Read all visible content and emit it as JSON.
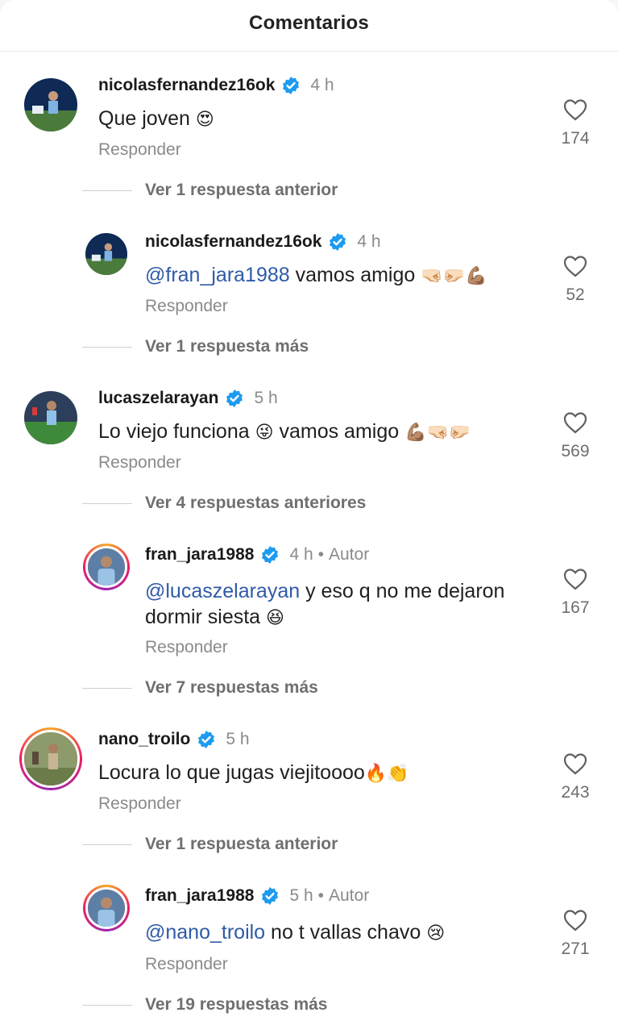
{
  "header": {
    "title": "Comentarios"
  },
  "labels": {
    "reply": "Responder",
    "author": "Autor"
  },
  "comments": [
    {
      "username": "nicolasfernandez16ok",
      "time": "4 h",
      "mention": "",
      "text": "Que joven",
      "emoji": "😍",
      "likes": "174"
    },
    {
      "username": "nicolasfernandez16ok",
      "time": "4 h",
      "mention": "@fran_jara1988",
      "text": " vamos amigo ",
      "emoji": "🤜🏻🤛🏻💪🏽",
      "likes": "52"
    },
    {
      "username": "lucaszelarayan",
      "time": "5 h",
      "mention": "",
      "text": "Lo viejo funciona ",
      "emoji": "😜",
      "text_after": " vamos amigo ",
      "emoji_after": "💪🏽🤜🏻🤛🏻",
      "likes": "569"
    },
    {
      "username": "fran_jara1988",
      "time": "4 h",
      "is_author": true,
      "mention": "@lucaszelarayan",
      "text": " y eso q no me dejaron",
      "line2": "dormir siesta ",
      "emoji": "😆",
      "likes": "167"
    },
    {
      "username": "nano_troilo",
      "time": "5 h",
      "mention": "",
      "text": "Locura lo que jugas viejitoooo",
      "emoji": "🔥👏",
      "likes": "243"
    },
    {
      "username": "fran_jara1988",
      "time": "5 h",
      "is_author": true,
      "mention": "@nano_troilo",
      "text": " no t vallas chavo ",
      "emoji": "😢",
      "likes": "271"
    }
  ],
  "more_links": [
    "Ver 1 respuesta anterior",
    "Ver 1 respuesta más",
    "Ver 4 respuestas anteriores",
    "Ver 7 respuestas más",
    "Ver 1 respuesta anterior",
    "Ver 19 respuestas más"
  ],
  "colors": {
    "verified": "#1d9bf0",
    "mention": "#2f5aa8",
    "muted": "#8a8a8a"
  }
}
